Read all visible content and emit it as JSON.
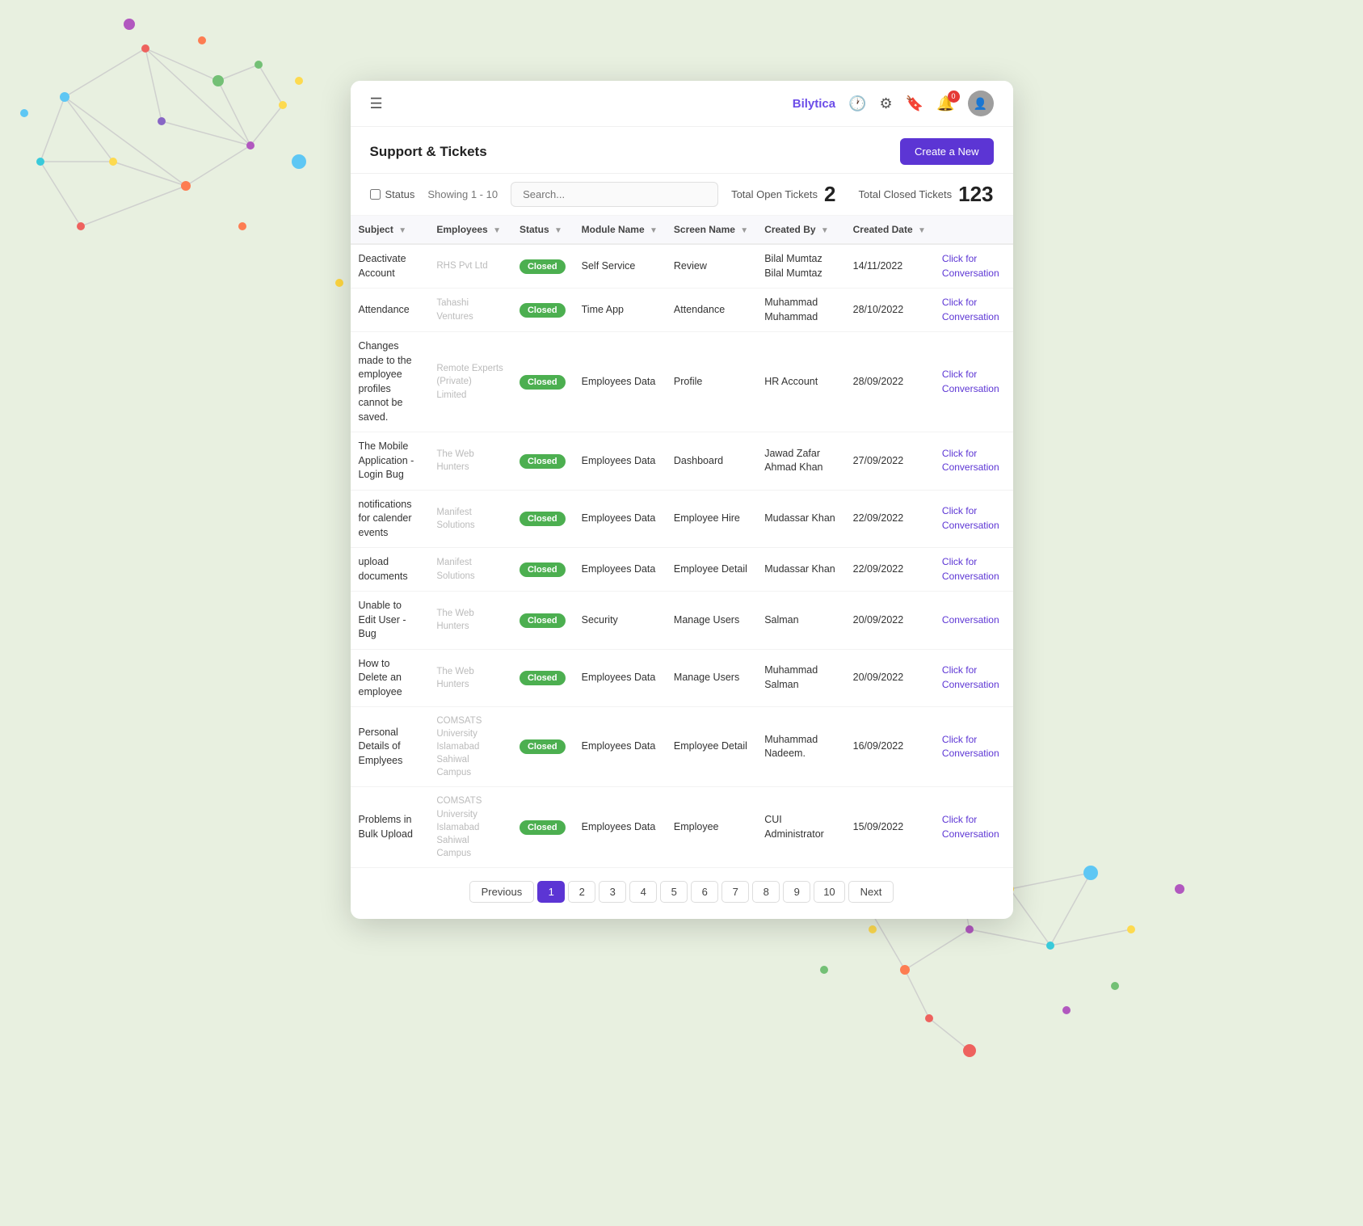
{
  "brand": "Bilytica",
  "navbar": {
    "hamburger_icon": "☰",
    "clock_icon": "🕐",
    "gear_icon": "⚙",
    "bookmark_icon": "🔖",
    "notif_icon": "🔔",
    "notif_count": "0"
  },
  "page": {
    "title": "Support & Tickets",
    "create_button": "Create a New"
  },
  "toolbar": {
    "status_label": "Status",
    "showing_label": "Showing 1 - 10",
    "search_placeholder": "Search...",
    "open_label": "Total Open Tickets",
    "open_count": "2",
    "closed_label": "Total Closed Tickets",
    "closed_count": "123"
  },
  "table": {
    "columns": [
      "Subject",
      "Employees",
      "Status",
      "Module Name",
      "Screen Name",
      "Created By",
      "Created Date",
      ""
    ],
    "rows": [
      {
        "subject": "Deactivate Account",
        "employees": "RHS Pvt Ltd",
        "status": "Closed",
        "module": "Self Service",
        "screen": "Review",
        "created_by": "Bilal Mumtaz Bilal Mumtaz",
        "date": "14/11/2022",
        "conv": "Click for Conversation"
      },
      {
        "subject": "Attendance",
        "employees": "Tahashi Ventures",
        "status": "Closed",
        "module": "Time App",
        "screen": "Attendance",
        "created_by": "Muhammad Muhammad",
        "date": "28/10/2022",
        "conv": "Click for Conversation"
      },
      {
        "subject": "Changes made to the employee profiles cannot be saved.",
        "employees": "Remote Experts (Private) Limited",
        "status": "Closed",
        "module": "Employees Data",
        "screen": "Profile",
        "created_by": "HR Account",
        "date": "28/09/2022",
        "conv": "Click for Conversation"
      },
      {
        "subject": "The Mobile Application - Login Bug",
        "employees": "The Web Hunters",
        "status": "Closed",
        "module": "Employees Data",
        "screen": "Dashboard",
        "created_by": "Jawad Zafar Ahmad Khan",
        "date": "27/09/2022",
        "conv": "Click for Conversation"
      },
      {
        "subject": "notifications for calender events",
        "employees": "Manifest Solutions",
        "status": "Closed",
        "module": "Employees Data",
        "screen": "Employee Hire",
        "created_by": "Mudassar Khan",
        "date": "22/09/2022",
        "conv": "Click for Conversation"
      },
      {
        "subject": "upload documents",
        "employees": "Manifest Solutions",
        "status": "Closed",
        "module": "Employees Data",
        "screen": "Employee Detail",
        "created_by": "Mudassar Khan",
        "date": "22/09/2022",
        "conv": "Click for Conversation"
      },
      {
        "subject": "Unable to Edit User - Bug",
        "employees": "The Web Hunters",
        "status": "Closed",
        "module": "Security",
        "screen": "Manage Users",
        "created_by": "Salman",
        "date": "20/09/2022",
        "conv": "Conversation"
      },
      {
        "subject": "How to Delete an employee",
        "employees": "The Web Hunters",
        "status": "Closed",
        "module": "Employees Data",
        "screen": "Manage Users",
        "created_by": "Muhammad Salman",
        "date": "20/09/2022",
        "conv": "Click for Conversation"
      },
      {
        "subject": "Personal Details of Emplyees",
        "employees": "COMSATS University Islamabad Sahiwal Campus",
        "status": "Closed",
        "module": "Employees Data",
        "screen": "Employee Detail",
        "created_by": "Muhammad Nadeem.",
        "date": "16/09/2022",
        "conv": "Click for Conversation"
      },
      {
        "subject": "Problems in Bulk Upload",
        "employees": "COMSATS University Islamabad Sahiwal Campus",
        "status": "Closed",
        "module": "Employees Data",
        "screen": "Employee",
        "created_by": "CUI Administrator",
        "date": "15/09/2022",
        "conv": "Click for Conversation"
      }
    ]
  },
  "pagination": {
    "prev_label": "Previous",
    "next_label": "Next",
    "pages": [
      "1",
      "2",
      "3",
      "4",
      "5",
      "6",
      "7",
      "8",
      "9",
      "10"
    ],
    "active": "1"
  }
}
